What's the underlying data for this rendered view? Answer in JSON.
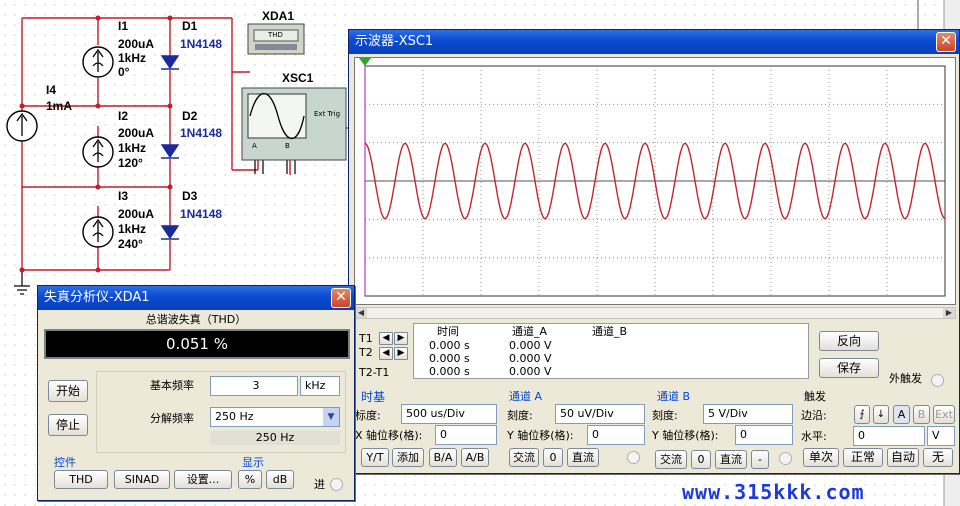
{
  "schematic": {
    "i4": {
      "name": "I4",
      "value": "1mA"
    },
    "sources": [
      {
        "name": "I1",
        "current": "200uA",
        "freq": "1kHz",
        "phase": "0°",
        "diode": "D1",
        "diode_model": "1N4148"
      },
      {
        "name": "I2",
        "current": "200uA",
        "freq": "1kHz",
        "phase": "120°",
        "diode": "D2",
        "diode_model": "1N4148"
      },
      {
        "name": "I3",
        "current": "200uA",
        "freq": "1kHz",
        "phase": "240°",
        "diode": "D3",
        "diode_model": "1N4148"
      }
    ],
    "xda": {
      "label": "XDA1",
      "inner": "THD"
    },
    "xsc": {
      "label": "XSC1",
      "ext_trig": "Ext Trig",
      "a": "A",
      "b": "B"
    }
  },
  "scope": {
    "title": "示波器-XSC1",
    "close": "✕",
    "readout": {
      "t1": "T1",
      "t2": "T2",
      "t2t1": "T2-T1",
      "headers": [
        "时间",
        "通道_A",
        "通道_B"
      ],
      "rows": [
        {
          "time": "0.000 s",
          "a": "0.000 V",
          "b": ""
        },
        {
          "time": "0.000 s",
          "a": "0.000 V",
          "b": ""
        },
        {
          "time": "0.000 s",
          "a": "0.000 V",
          "b": ""
        }
      ],
      "reverse": "反向",
      "save": "保存",
      "ext_trigger": "外触发"
    },
    "timebase": {
      "title": "时基",
      "scale_label": "标度:",
      "scale": "500 us/Div",
      "xpos_label": "X 轴位移(格):",
      "xpos": "0",
      "modes": [
        "Y/T",
        "添加",
        "B/A",
        "A/B"
      ]
    },
    "channel_a": {
      "title": "通道 A",
      "scale_label": "刻度:",
      "scale": "50 uV/Div",
      "ypos_label": "Y 轴位移(格):",
      "ypos": "0",
      "coupling": [
        "交流",
        "0",
        "直流"
      ]
    },
    "channel_b": {
      "title": "通道 B",
      "scale_label": "刻度:",
      "scale": "5 V/Div",
      "ypos_label": "Y 轴位移(格):",
      "ypos": "0",
      "coupling": [
        "交流",
        "0",
        "直流",
        "-"
      ]
    },
    "trigger": {
      "title": "触发",
      "edge_label": "边沿:",
      "edge_buttons": [
        "A",
        "B",
        "Ext"
      ],
      "level_label": "水平:",
      "level": "0",
      "level_unit": "V",
      "modes": [
        "单次",
        "正常",
        "自动",
        "无"
      ]
    },
    "waveform": {
      "cycles": 14.5,
      "amplitude_div": 0.98,
      "color": "#c0272d"
    }
  },
  "thd": {
    "title": "失真分析仪-XDA1",
    "close": "✕",
    "thd_heading": "总谐波失真（THD）",
    "thd_value": "0.051 %",
    "start": "开始",
    "stop": "停止",
    "fund_freq_label": "基本频率",
    "fund_freq": "3",
    "fund_freq_unit": "kHz",
    "resolution_label": "分解频率",
    "resolution": "250 Hz",
    "resolution_readout": "250 Hz",
    "controls_title": "控件",
    "controls": [
      "THD",
      "SINAD",
      "设置..."
    ],
    "display_title": "显示",
    "display": [
      "%",
      "dB"
    ],
    "in_label": "进"
  },
  "watermark": "www.315kkk.com"
}
